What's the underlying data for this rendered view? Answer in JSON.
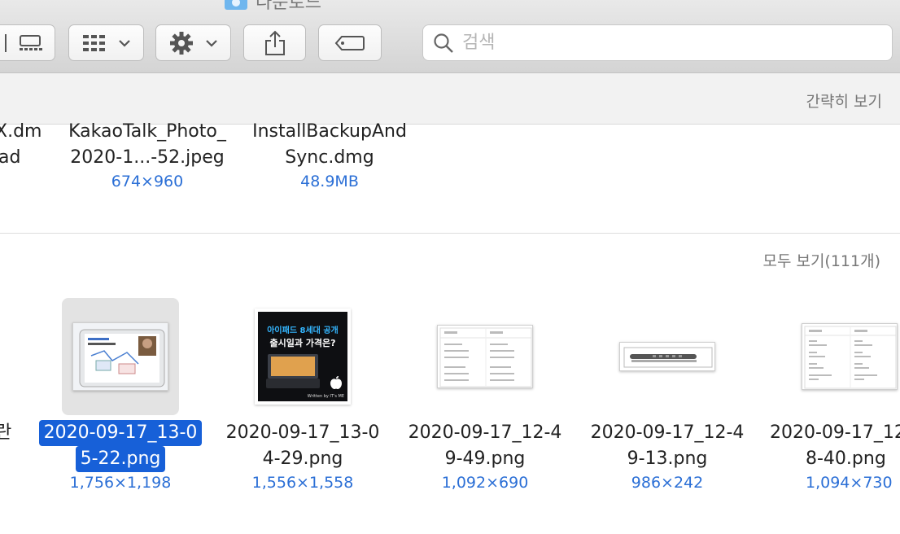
{
  "window": {
    "title": "다운로드"
  },
  "toolbar": {
    "search_placeholder": "검색"
  },
  "recents": {
    "show_less_label": "간략히 보기",
    "files": [
      {
        "name_line1": "X.dm",
        "name_line2": "ad",
        "meta": ""
      },
      {
        "name_line1": "KakaoTalk_Photo_",
        "name_line2": "2020-1...-52.jpeg",
        "meta": "674×960"
      },
      {
        "name_line1": "InstallBackupAnd",
        "name_line2": "Sync.dmg",
        "meta": "48.9MB"
      }
    ]
  },
  "all": {
    "show_all_label": "모두 보기(111개)",
    "partial_left": "란",
    "files": [
      {
        "name_line1": "2020-09-17_13-0",
        "name_line2": "5-22.png",
        "meta": "1,756×1,198",
        "selected": true
      },
      {
        "name_line1": "2020-09-17_13-0",
        "name_line2": "4-29.png",
        "meta": "1,556×1,558"
      },
      {
        "name_line1": "2020-09-17_12-4",
        "name_line2": "9-49.png",
        "meta": "1,092×690"
      },
      {
        "name_line1": "2020-09-17_12-4",
        "name_line2": "9-13.png",
        "meta": "986×242"
      },
      {
        "name_line1": "2020-09-17_12",
        "name_line2": "8-40.png",
        "meta": "1,094×730"
      }
    ],
    "thumb2_text_line1": "아이패드 8세대 공개",
    "thumb2_text_line2": "출시일과 가격은?",
    "thumb2_credit": "Written by IT's ME"
  },
  "colors": {
    "accent": "#1760d8",
    "meta_blue": "#2b6fd6"
  }
}
